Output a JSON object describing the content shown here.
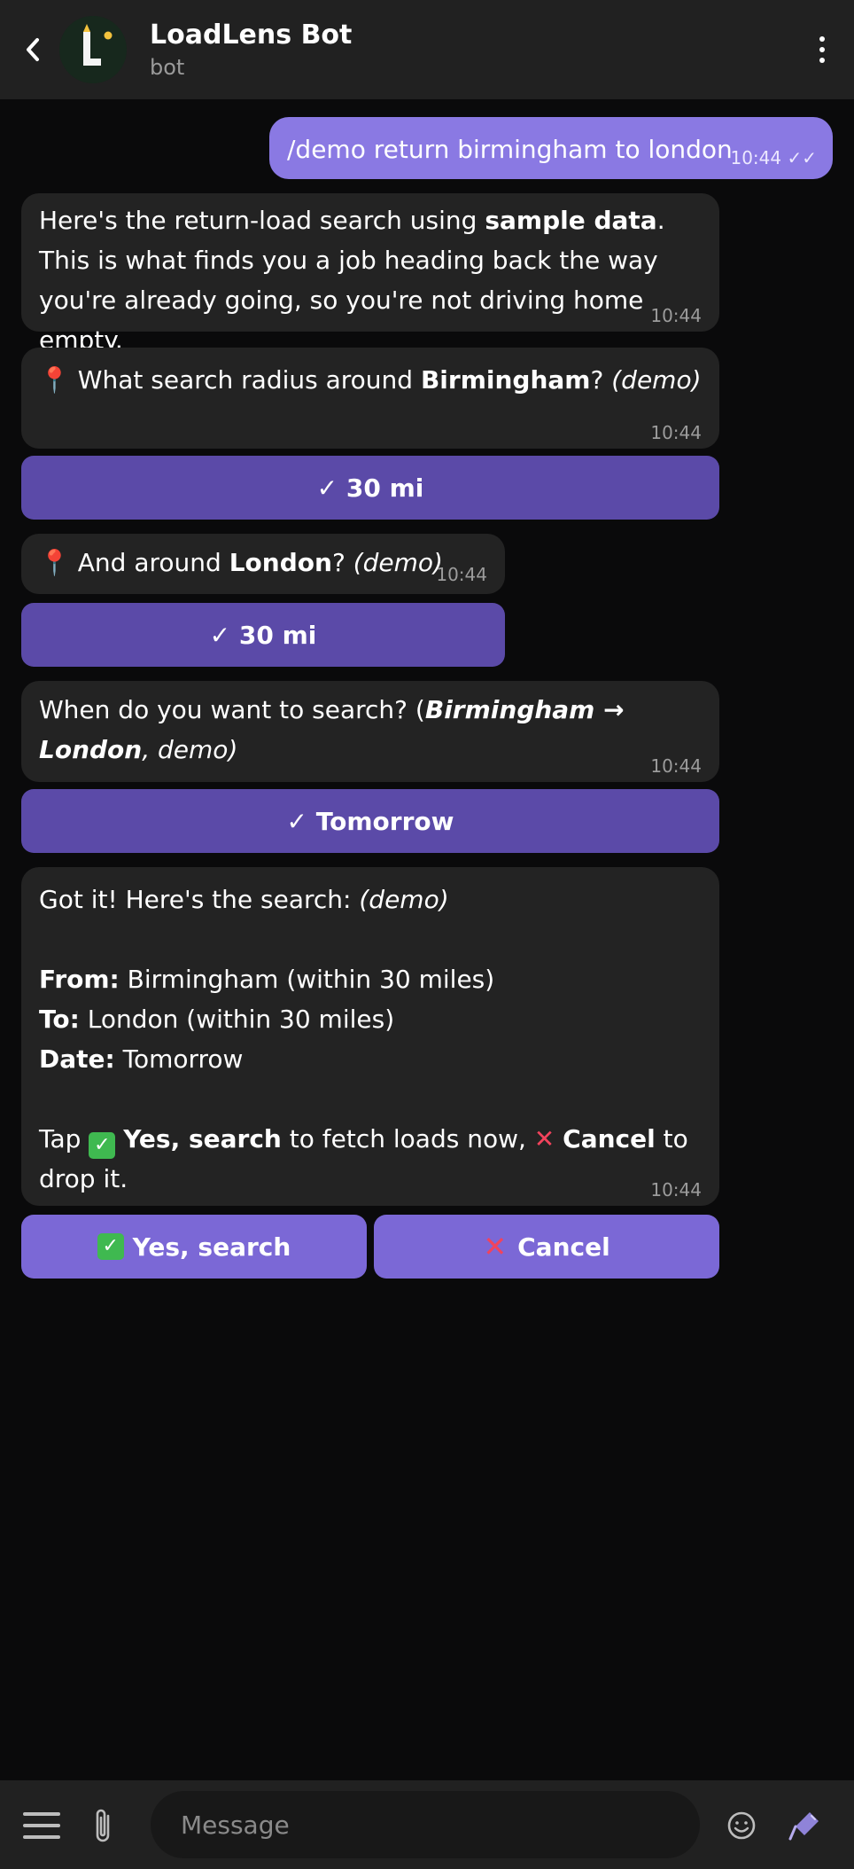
{
  "header": {
    "title": "LoadLens Bot",
    "subtitle": "bot",
    "avatar_letter": "L"
  },
  "messages": {
    "m1": {
      "text": "/demo return birmingham to london",
      "time": "10:44"
    },
    "m2": {
      "a": "Here's the return-load search using ",
      "b": "sample data",
      "c": ". This is what finds you a job heading back the way you're already going, so you're not driving home empty.",
      "time": "10:44"
    },
    "m3": {
      "a": "What search radius around ",
      "b": "Birmingham",
      "c": "? ",
      "d": "(demo)",
      "time": "10:44"
    },
    "m4": {
      "a": "And around ",
      "b": "London",
      "c": "? ",
      "d": "(demo)",
      "time": "10:44"
    },
    "m5": {
      "a": "When do you want to search? (",
      "b": "Birmingham → London",
      "c": ", demo)",
      "time": "10:44"
    },
    "m6": {
      "l1a": "Got it! Here's the search: ",
      "l1b": "(demo)",
      "from_label": "From:",
      "from_value": " Birmingham (within 30 miles)",
      "to_label": "To:",
      "to_value": " London (within 30 miles)",
      "date_label": "Date:",
      "date_value": " Tomorrow",
      "t1": "Tap ",
      "t2": "Yes, search",
      "t3": " to fetch loads now, ",
      "t4": "Cancel",
      "t5": " to drop it.",
      "time": "10:44"
    }
  },
  "buttons": {
    "radius_birmingham": "✓ 30 mi",
    "radius_london": "✓ 30 mi",
    "date": "✓ Tomorrow",
    "yes_search": "Yes, search",
    "cancel": "Cancel"
  },
  "composer": {
    "placeholder": "Message"
  },
  "colors": {
    "accent": "#8a79e3",
    "button": "#5b4aa8",
    "bubble": "#232323",
    "background": "#0a0a0b"
  },
  "icons": [
    "back-arrow-icon",
    "more-vert-icon",
    "pin-icon",
    "check-mark-icon",
    "cross-mark-icon",
    "menu-icon",
    "paperclip-icon",
    "emoji-icon",
    "microphone-icon",
    "double-check-icon"
  ]
}
